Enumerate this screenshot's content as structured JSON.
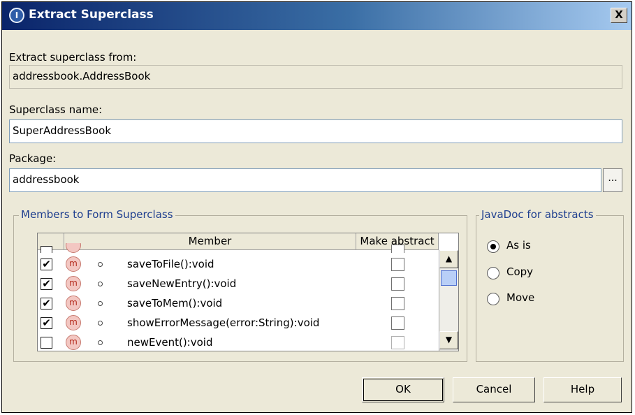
{
  "window": {
    "title": "Extract Superclass",
    "icon": "intellij-icon",
    "close_label": "X"
  },
  "extract_from": {
    "label": "Extract superclass from:",
    "value": "addressbook.AddressBook"
  },
  "superclass_name": {
    "label": "Superclass name:",
    "value": "SuperAddressBook"
  },
  "package": {
    "label": "Package:",
    "value": "addressbook",
    "browse_label": "..."
  },
  "members": {
    "group_label": "Members to Form Superclass",
    "columns": [
      "",
      "Member",
      "Make abstract"
    ],
    "rows": [
      {
        "checked": false,
        "icon": "method-icon",
        "name": "...",
        "abstract": false
      },
      {
        "checked": true,
        "icon": "method-icon",
        "name": "saveToFile():void",
        "abstract": false
      },
      {
        "checked": true,
        "icon": "method-icon",
        "name": "saveNewEntry():void",
        "abstract": false
      },
      {
        "checked": true,
        "icon": "method-icon",
        "name": "saveToMem():void",
        "abstract": false
      },
      {
        "checked": true,
        "icon": "method-icon",
        "name": "showErrorMessage(error:String):void",
        "abstract": false
      },
      {
        "checked": false,
        "icon": "method-icon",
        "name": "newEvent():void",
        "abstract": false
      }
    ]
  },
  "javadoc": {
    "group_label": "JavaDoc for abstracts",
    "options": [
      {
        "label": "As is",
        "selected": true
      },
      {
        "label": "Copy",
        "selected": false
      },
      {
        "label": "Move",
        "selected": false
      }
    ]
  },
  "buttons": {
    "ok": "OK",
    "cancel": "Cancel",
    "help": "Help"
  }
}
